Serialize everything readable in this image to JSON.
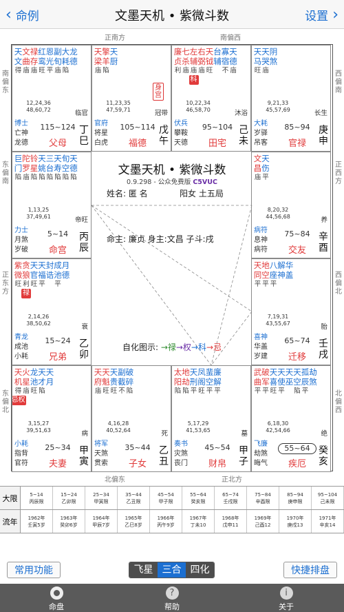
{
  "nav": {
    "back": "命例",
    "title": "文墨天机 • 紫微斗数",
    "settings": "设置"
  },
  "directions": {
    "top_left": "正南方",
    "top_right": "南偏西",
    "bottom_left": "北偏东",
    "bottom_right": "正北方",
    "left": [
      "南偏东",
      "东偏南",
      "正东方",
      "东偏北"
    ],
    "right": [
      "西偏南",
      "正西方",
      "西偏北",
      "北偏西"
    ]
  },
  "colors": {
    "blue": "#1c6fd1",
    "red": "#e13b3b",
    "green": "#2e8b2e",
    "purple": "#6a2ea6",
    "dark": "#222222"
  },
  "palaces": [
    {
      "id": "si",
      "stars": [
        {
          "n": "天文",
          "c": "blue",
          "b": "得"
        },
        {
          "n": "文曲",
          "c": "red",
          "b": "庙"
        },
        {
          "n": "禄存",
          "c": "red",
          "b": "庙"
        },
        {
          "n": "红鸾",
          "c": "blue",
          "b": "旺"
        },
        {
          "n": "恩光",
          "c": "blue",
          "b": "平"
        },
        {
          "n": "副旬",
          "c": "blue",
          "b": "庙"
        },
        {
          "n": "大耗",
          "c": "blue",
          "b": "陷"
        },
        {
          "n": "龙德",
          "c": "blue",
          "b": ""
        }
      ],
      "tag": "",
      "age1": "12,24,36",
      "age2": "48,60,72",
      "stage": "临官",
      "g1": "博士",
      "g2": "亡神",
      "g3": "龙德",
      "range": "115~124",
      "palace": "父母",
      "gz": "丁巳",
      "boxed": false
    },
    {
      "id": "wu",
      "stars": [
        {
          "n": "天梁",
          "c": "red",
          "b": "庙"
        },
        {
          "n": "擎羊",
          "c": "red",
          "b": "陷"
        },
        {
          "n": "天厨",
          "c": "blue",
          "b": ""
        }
      ],
      "tag": "身宫",
      "age1": "11,23,35",
      "age2": "47,59,71",
      "stage": "冠带",
      "g1": "官府",
      "g2": "将星",
      "g3": "白虎",
      "range": "105~114",
      "palace": "福德",
      "gz": "戊午",
      "boxed": false
    },
    {
      "id": "wei",
      "stars": [
        {
          "n": "廉贞",
          "c": "red",
          "b": "利"
        },
        {
          "n": "七杀",
          "c": "red",
          "b": "庙"
        },
        {
          "n": "左辅",
          "c": "red",
          "b": "庙"
        },
        {
          "n": "右弼",
          "c": "red",
          "b": "庙"
        },
        {
          "n": "天钺",
          "c": "red",
          "b": "旺"
        },
        {
          "n": "台辅",
          "c": "blue",
          "b": ""
        },
        {
          "n": "寡宿",
          "c": "blue",
          "b": "不"
        },
        {
          "n": "天德",
          "c": "blue",
          "b": "庙"
        }
      ],
      "tag": "",
      "hua": {
        "text": "科",
        "color": "red",
        "pos": 2
      },
      "age1": "10,22,34",
      "age2": "46,58,70",
      "stage": "沐浴",
      "g1": "伏兵",
      "g2": "攀鞍",
      "g3": "天德",
      "range": "95~104",
      "palace": "田宅",
      "gz": "己未",
      "boxed": false
    },
    {
      "id": "shen",
      "stars": [
        {
          "n": "天马",
          "c": "blue",
          "b": "旺"
        },
        {
          "n": "天哭",
          "c": "blue",
          "b": "庙"
        },
        {
          "n": "阴煞",
          "c": "blue",
          "b": ""
        }
      ],
      "tag": "",
      "age1": "9,21,33",
      "age2": "45,57,69",
      "stage": "长生",
      "g1": "大耗",
      "g2": "岁驿",
      "g3": "吊客",
      "range": "85~94",
      "palace": "官禄",
      "gz": "庚申",
      "boxed": false
    },
    {
      "id": "chen",
      "stars": [
        {
          "n": "巨门",
          "c": "blue",
          "b": "陷"
        },
        {
          "n": "陀罗",
          "c": "red",
          "b": "庙"
        },
        {
          "n": "铃星",
          "c": "red",
          "b": "陷"
        },
        {
          "n": "天姚",
          "c": "blue",
          "b": "陷"
        },
        {
          "n": "三台",
          "c": "blue",
          "b": "陷"
        },
        {
          "n": "天寿",
          "c": "blue",
          "b": "陷"
        },
        {
          "n": "旬空",
          "c": "blue",
          "b": "陷"
        },
        {
          "n": "天德",
          "c": "blue",
          "b": "陷"
        }
      ],
      "tag": "",
      "age1": "1,13,25",
      "age2": "37,49,61",
      "stage": "帝旺",
      "g1": "力士",
      "g2": "月煞",
      "g3": "岁破",
      "range": "5~14",
      "palace": "命宫",
      "gz": "丙辰",
      "boxed": false
    },
    {
      "id": "you",
      "stars": [
        {
          "n": "文昌",
          "c": "red",
          "b": "庙"
        },
        {
          "n": "天伤",
          "c": "blue",
          "b": "平"
        }
      ],
      "tag": "",
      "age1": "8,20,32",
      "age2": "44,56,68",
      "stage": "养",
      "g1": "病符",
      "g2": "息神",
      "g3": "病符",
      "range": "75~84",
      "palace": "交友",
      "gz": "辛酉",
      "boxed": false
    },
    {
      "id": "mao",
      "stars": [
        {
          "n": "紫微",
          "c": "red",
          "b": "旺"
        },
        {
          "n": "贪狼",
          "c": "red",
          "b": "利"
        },
        {
          "n": "天官",
          "c": "blue",
          "b": "旺"
        },
        {
          "n": "天福",
          "c": "blue",
          "b": "平"
        },
        {
          "n": "封诰",
          "c": "blue",
          "b": ""
        },
        {
          "n": "成池",
          "c": "blue",
          "b": "平"
        },
        {
          "n": "月德",
          "c": "blue",
          "b": ""
        }
      ],
      "tag": "",
      "hua": {
        "text": "禄",
        "color": "red",
        "pos": 1
      },
      "age1": "2,14,26",
      "age2": "38,50,62",
      "stage": "衰",
      "g1": "青龙",
      "g2": "成池",
      "g3": "小耗",
      "range": "15~24",
      "palace": "兄弟",
      "gz": "乙卯",
      "boxed": false
    },
    {
      "id": "xu",
      "stars": [
        {
          "n": "天同",
          "c": "red",
          "b": "平"
        },
        {
          "n": "地空",
          "c": "red",
          "b": "平"
        },
        {
          "n": "八座",
          "c": "blue",
          "b": "平"
        },
        {
          "n": "解神",
          "c": "blue",
          "b": ""
        },
        {
          "n": "华盖",
          "c": "blue",
          "b": ""
        }
      ],
      "tag": "",
      "age1": "7,19,31",
      "age2": "43,55,67",
      "stage": "胎",
      "g1": "喜神",
      "g2": "华盖",
      "g3": "岁建",
      "range": "65~74",
      "palace": "迁移",
      "gz": "壬戌",
      "boxed": false
    },
    {
      "id": "yin",
      "stars": [
        {
          "n": "天机",
          "c": "red",
          "b": "得"
        },
        {
          "n": "火星",
          "c": "red",
          "b": "庙"
        },
        {
          "n": "龙池",
          "c": "blue",
          "b": "旺"
        },
        {
          "n": "天才",
          "c": "blue",
          "b": "陷"
        },
        {
          "n": "天月",
          "c": "blue",
          "b": ""
        }
      ],
      "tag": "",
      "hua": {
        "text": "忌权",
        "color": "red",
        "pos": 0
      },
      "age1": "3,15,27",
      "age2": "39,51,63",
      "stage": "病",
      "g1": "小耗",
      "g2": "指背",
      "g3": "官符",
      "range": "25~34",
      "palace": "夫妻",
      "gz": "甲寅",
      "boxed": false
    },
    {
      "id": "chou",
      "stars": [
        {
          "n": "天府",
          "c": "red",
          "b": "庙"
        },
        {
          "n": "天魁",
          "c": "red",
          "b": "旺"
        },
        {
          "n": "天贵",
          "c": "blue",
          "b": "旺"
        },
        {
          "n": "副截",
          "c": "blue",
          "b": "不"
        },
        {
          "n": "破碎",
          "c": "blue",
          "b": "陷"
        }
      ],
      "tag": "",
      "age1": "4,16,28",
      "age2": "40,52,64",
      "stage": "死",
      "g1": "将军",
      "g2": "天煞",
      "g3": "贯索",
      "range": "35~44",
      "palace": "子女",
      "gz": "乙丑",
      "boxed": false
    },
    {
      "id": "zi",
      "stars": [
        {
          "n": "太阳",
          "c": "red",
          "b": "陷"
        },
        {
          "n": "地劫",
          "c": "red",
          "b": "陷"
        },
        {
          "n": "天刑",
          "c": "blue",
          "b": "平"
        },
        {
          "n": "凤阁",
          "c": "blue",
          "b": "旺"
        },
        {
          "n": "蜚空",
          "c": "blue",
          "b": "平"
        },
        {
          "n": "廉解",
          "c": "blue",
          "b": "平"
        }
      ],
      "tag": "",
      "age1": "5,17,29",
      "age2": "41,53,65",
      "stage": "墓",
      "g1": "奏书",
      "g2": "灾煞",
      "g3": "丧门",
      "range": "45~54",
      "palace": "财帛",
      "gz": "甲子",
      "boxed": false
    },
    {
      "id": "hai",
      "stars": [
        {
          "n": "武曲",
          "c": "red",
          "b": "平"
        },
        {
          "n": "破军",
          "c": "red",
          "b": "平"
        },
        {
          "n": "天喜",
          "c": "blue",
          "b": "旺"
        },
        {
          "n": "天使",
          "c": "blue",
          "b": "平"
        },
        {
          "n": "天巫",
          "c": "blue",
          "b": ""
        },
        {
          "n": "天空",
          "c": "blue",
          "b": "陷"
        },
        {
          "n": "孤辰",
          "c": "blue",
          "b": "平"
        },
        {
          "n": "劫煞",
          "c": "blue",
          "b": ""
        }
      ],
      "tag": "",
      "age1": "6,18,30",
      "age2": "42,54,66",
      "stage": "绝",
      "g1": "飞廉",
      "g2": "劫煞",
      "g3": "晦气",
      "range": "55~64",
      "palace": "疾厄",
      "gz": "癸亥",
      "boxed": true
    }
  ],
  "center": {
    "title": "文墨天机 • 紫微斗数",
    "version": "0.9.298 - 公众免费版",
    "code": "C5VUC",
    "name": "姓名: 匿 名",
    "gender": "阳女 土五局",
    "lords": "命主: 廉贞 身主:文昌  子斗:戌",
    "sihua_label": "自化图示:",
    "sihua": [
      "→禄",
      "→权",
      "→科",
      "→忌"
    ]
  },
  "table": {
    "dax_label": "大限",
    "flow_label": "流年",
    "dax": [
      [
        "5~14",
        "丙辰限"
      ],
      [
        "15~24",
        "乙卯限"
      ],
      [
        "25~34",
        "甲寅限"
      ],
      [
        "35~44",
        "乙丑限"
      ],
      [
        "45~54",
        "甲子限"
      ],
      [
        "55~64",
        "癸亥限"
      ],
      [
        "65~74",
        "壬戌限"
      ],
      [
        "75~84",
        "辛酉限"
      ],
      [
        "85~94",
        "庚申限"
      ],
      [
        "95~104",
        "己未限"
      ]
    ],
    "flow": [
      [
        "1962年",
        "壬寅5岁"
      ],
      [
        "1963年",
        "癸卯6岁"
      ],
      [
        "1964年",
        "甲辰7岁"
      ],
      [
        "1965年",
        "乙巳8岁"
      ],
      [
        "1966年",
        "丙午9岁"
      ],
      [
        "1967年",
        "丁未10"
      ],
      [
        "1968年",
        "戊申11"
      ],
      [
        "1969年",
        "己酉12"
      ],
      [
        "1970年",
        "庚戌13"
      ],
      [
        "1971年",
        "辛亥14"
      ]
    ]
  },
  "toolbar": {
    "left": "常用功能",
    "seg": [
      "飞星",
      "三合",
      "四化"
    ],
    "seg_active": 1,
    "right": "快捷排盘"
  },
  "tabs": [
    {
      "label": "命盘",
      "icon": "chart-icon"
    },
    {
      "label": "帮助",
      "icon": "help-icon"
    },
    {
      "label": "关于",
      "icon": "info-icon"
    }
  ]
}
